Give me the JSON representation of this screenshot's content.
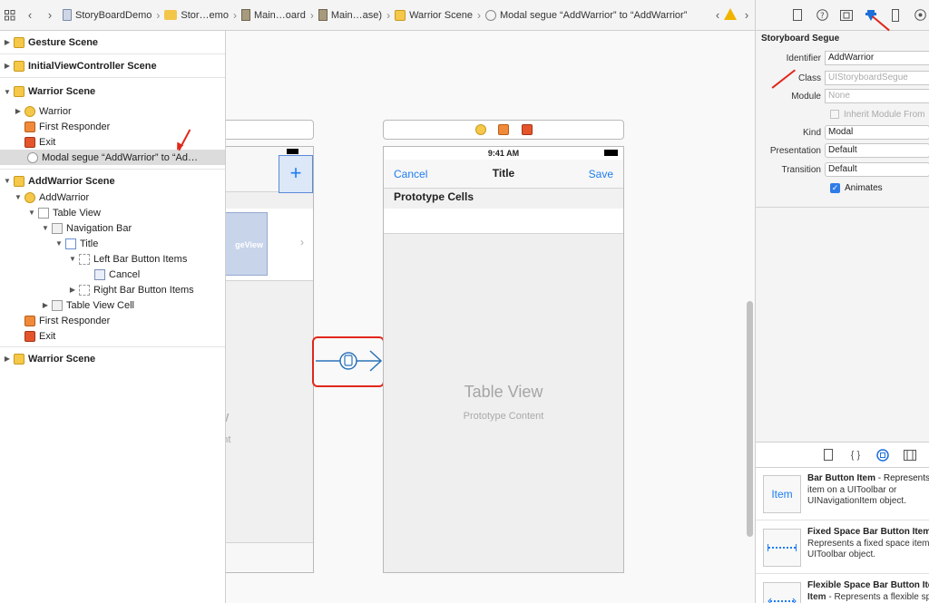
{
  "jumpbar": {
    "crumbs": [
      "StoryBoardDemo",
      "Stor…emo",
      "Main…oard",
      "Main…ase)",
      "Warrior Scene",
      "Modal segue “AddWarrior” to “AddWarrior”"
    ]
  },
  "outline": {
    "gesture_scene": "Gesture Scene",
    "initial_scene": "InitialViewController Scene",
    "warrior_scene": "Warrior Scene",
    "warrior": "Warrior",
    "first_responder_1": "First Responder",
    "exit_1": "Exit",
    "segue": "Modal segue “AddWarrior” to “Ad…",
    "addwarrior_scene": "AddWarrior Scene",
    "addwarrior": "AddWarrior",
    "table_view": "Table View",
    "navigation_bar": "Navigation Bar",
    "title": "Title",
    "left_bar_items": "Left Bar Button Items",
    "cancel": "Cancel",
    "right_bar_items": "Right Bar Button Items",
    "table_view_cell": "Table View Cell",
    "first_responder_2": "First Responder",
    "exit_2": "Exit",
    "warrior_scene_2": "Warrior Scene"
  },
  "canvas": {
    "left_phone": {
      "page_view_label": "geView",
      "bg_big_1": "w",
      "bg_small_1": "ntent",
      "plus": "+"
    },
    "right_phone": {
      "time": "9:41 AM",
      "cancel": "Cancel",
      "title": "Title",
      "save": "Save",
      "prototype_cells": "Prototype Cells",
      "table_view": "Table View",
      "prototype_content": "Prototype Content"
    }
  },
  "inspector": {
    "section_title": "Storyboard Segue",
    "identifier_label": "Identifier",
    "identifier_value": "AddWarrior",
    "class_label": "Class",
    "class_placeholder": "UIStoryboardSegue",
    "module_label": "Module",
    "module_placeholder": "None",
    "inherit_label": "Inherit Module From",
    "kind_label": "Kind",
    "kind_value": "Modal",
    "presentation_label": "Presentation",
    "presentation_value": "Default",
    "transition_label": "Transition",
    "transition_value": "Default",
    "animates_label": "Animates",
    "animates_checked": true
  },
  "library": {
    "items": [
      {
        "thumb": "Item",
        "title": "Bar Button Item",
        "desc1": " - Represents an",
        "desc2": "item on a UIToolbar or",
        "desc3": "UINavigationItem object."
      },
      {
        "thumb": "",
        "title": "Fixed Space Bar Button Item",
        "desc1": "",
        "desc2": "Represents a fixed space item",
        "desc3": "UIToolbar object."
      },
      {
        "thumb": "",
        "title": "Flexible Space Bar Button Item",
        "desc1": "",
        "desc2": "Item",
        "desc3": " - Represents a flexible space"
      }
    ]
  },
  "colors": {
    "accent": "#1d7cf2",
    "annotation": "#e0281b",
    "warning": "#f0b400"
  }
}
